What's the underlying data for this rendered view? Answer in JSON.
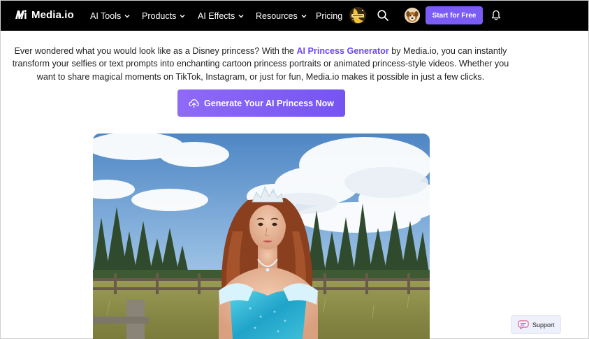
{
  "header": {
    "logo_text": "Media.io",
    "nav": [
      {
        "label": "AI Tools"
      },
      {
        "label": "Products"
      },
      {
        "label": "AI Effects"
      },
      {
        "label": "Resources"
      },
      {
        "label": "Pricing"
      }
    ],
    "start_button": "Start for Free"
  },
  "intro": {
    "part1": "Ever wondered what you would look like as a Disney princess? With the ",
    "link": "AI Princess Generator",
    "part2": " by Media.io, you can instantly transform your selfies or text prompts into enchanting cartoon princess portraits or animated princess-style videos. Whether you want to share magical moments on TikTok, Instagram, or just for fun, Media.io makes it possible in just a few clicks."
  },
  "cta": {
    "label": "Generate Your AI Princess Now"
  },
  "support": {
    "label": "Support"
  },
  "colors": {
    "accent": "#7b5cf5",
    "link": "#6c47f5",
    "nav_background": "#000000"
  },
  "icons": [
    "media-io-logo-icon",
    "chevron-down-icon",
    "search-icon",
    "bell-icon",
    "upload-cloud-icon",
    "chat-icon"
  ]
}
